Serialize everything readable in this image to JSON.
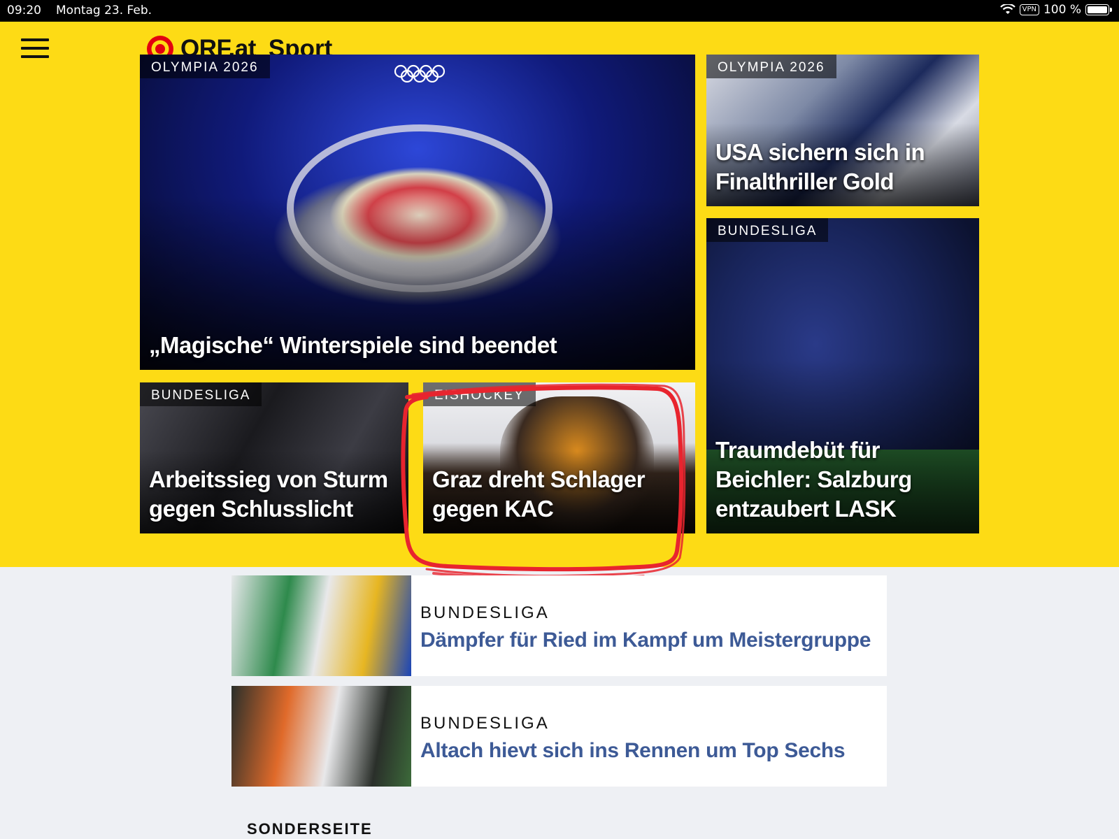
{
  "status_bar": {
    "time": "09:20",
    "date": "Montag 23. Feb.",
    "vpn": "VPN",
    "battery": "100 %"
  },
  "header": {
    "logo_text": "ORF.at",
    "section": "Sport",
    "brand_color": "#e3000f",
    "background": "#fddb15"
  },
  "tiles": [
    {
      "kicker": "OLYMPIA 2026",
      "headline": "„Magische“ Winterspiele sind beendet"
    },
    {
      "kicker": "OLYMPIA 2026",
      "headline": "USA sichern sich in Finalthriller Gold"
    },
    {
      "kicker": "BUNDESLIGA",
      "headline": "Traumdebüt für Beichler: Salzburg entzaubert LASK"
    },
    {
      "kicker": "BUNDESLIGA",
      "headline": "Arbeitssieg von Sturm gegen Schlusslicht"
    },
    {
      "kicker": "EISHOCKEY",
      "headline": "Graz dreht Schlager gegen KAC"
    }
  ],
  "list": [
    {
      "kicker": "BUNDESLIGA",
      "title": "Dämpfer für Ried im Kampf um Meistergruppe"
    },
    {
      "kicker": "BUNDESLIGA",
      "title": "Altach hievt sich ins Rennen um Top Sechs"
    }
  ],
  "section_label": "SONDERSEITE",
  "annotation_color": "#e8242e"
}
